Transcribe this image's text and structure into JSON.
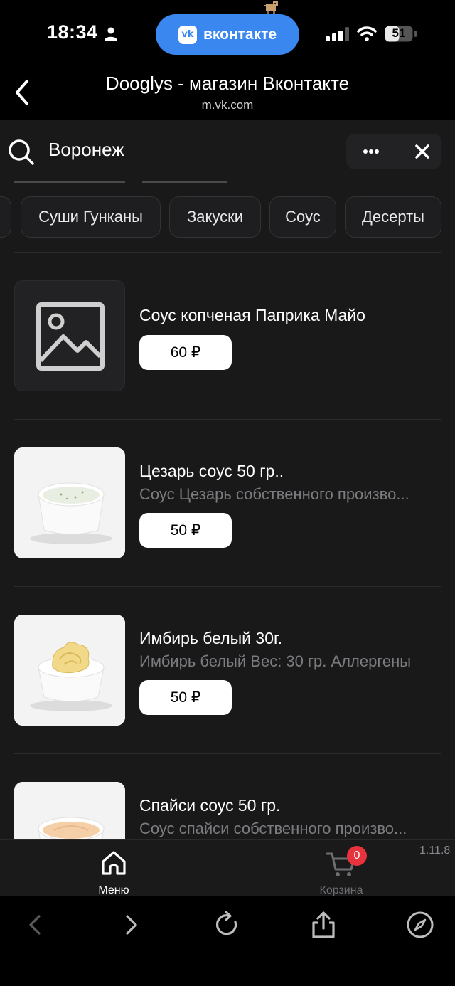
{
  "status": {
    "time": "18:34",
    "vk_label": "вконтакте",
    "vk_logo": "vk",
    "battery": "51"
  },
  "browser": {
    "title": "Dooglys - магазин Вконтакте",
    "url": "m.vk.com"
  },
  "shop": {
    "city": "Воронеж",
    "categories": [
      "Суши Гунканы",
      "Закуски",
      "Соус",
      "Десерты"
    ]
  },
  "products": [
    {
      "name": "Соус копченая Паприка Майо",
      "description": "",
      "price": "60 ₽",
      "image": "placeholder-image-icon"
    },
    {
      "name": "Цезарь соус 50 гр..",
      "description": "Соус Цезарь собственного произво...",
      "price": "50 ₽",
      "image": "caesar-sauce-photo"
    },
    {
      "name": "Имбирь белый 30г.",
      "description": "Имбирь белый  Вес: 30 гр.  Аллергены",
      "price": "50 ₽",
      "image": "ginger-photo"
    },
    {
      "name": "Спайси соус 50 гр.",
      "description": "Соус спайси собственного произво...",
      "price": "",
      "image": "spicy-sauce-photo"
    }
  ],
  "bottom_nav": {
    "menu_label": "Меню",
    "cart_label": "Корзина",
    "cart_count": "0",
    "version": "1.11.8"
  },
  "colors": {
    "background": "#19191a",
    "vk_blue": "#3a87f0",
    "badge_red": "#e8323c",
    "price_button": "#ffffff"
  }
}
